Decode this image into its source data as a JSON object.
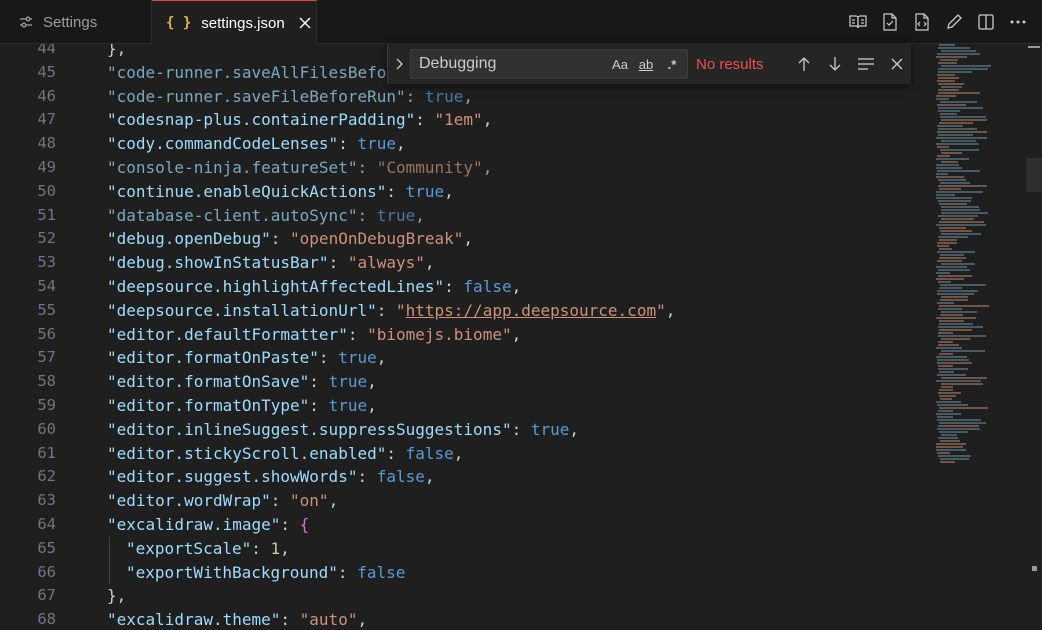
{
  "tabs": [
    {
      "label": "Settings",
      "icon": "settings-sliders-icon"
    },
    {
      "label": "settings.json",
      "icon": "json-braces-icon",
      "icon_text": "{ }",
      "active": true
    }
  ],
  "find": {
    "value": "Debugging",
    "options": {
      "match_case": "Aa",
      "whole_word": "ab",
      "regex": ".*"
    },
    "status": "No results"
  },
  "colors": {
    "key": "#9cdcfe",
    "string": "#ce9178",
    "keyword": "#569cd6",
    "number": "#b5cea8",
    "active_tab_border": "#e8443a",
    "no_results": "#f14c4c"
  },
  "lines": [
    {
      "num": "44",
      "text": "},"
    },
    {
      "num": "45",
      "key": "\"code-runner.saveAllFilesBeforeRun\"",
      "value": "true",
      "type": "kw",
      "dim": true
    },
    {
      "num": "46",
      "key": "\"code-runner.saveFileBeforeRun\"",
      "value": "true",
      "type": "kw",
      "dim": true
    },
    {
      "num": "47",
      "key": "\"codesnap-plus.containerPadding\"",
      "value": "\"1em\"",
      "type": "s"
    },
    {
      "num": "48",
      "key": "\"cody.commandCodeLenses\"",
      "value": "true",
      "type": "kw"
    },
    {
      "num": "49",
      "key": "\"console-ninja.featureSet\"",
      "value": "\"Community\"",
      "type": "s",
      "dim": true
    },
    {
      "num": "50",
      "key": "\"continue.enableQuickActions\"",
      "value": "true",
      "type": "kw"
    },
    {
      "num": "51",
      "key": "\"database-client.autoSync\"",
      "value": "true",
      "type": "kw",
      "dim": true
    },
    {
      "num": "52",
      "key": "\"debug.openDebug\"",
      "value": "\"openOnDebugBreak\"",
      "type": "s"
    },
    {
      "num": "53",
      "key": "\"debug.showInStatusBar\"",
      "value": "\"always\"",
      "type": "s"
    },
    {
      "num": "54",
      "key": "\"deepsource.highlightAffectedLines\"",
      "value": "false",
      "type": "kw"
    },
    {
      "num": "55",
      "key": "\"deepsource.installationUrl\"",
      "value": "https://app.deepsource.com",
      "type": "link"
    },
    {
      "num": "56",
      "key": "\"editor.defaultFormatter\"",
      "value": "\"biomejs.biome\"",
      "type": "s"
    },
    {
      "num": "57",
      "key": "\"editor.formatOnPaste\"",
      "value": "true",
      "type": "kw"
    },
    {
      "num": "58",
      "key": "\"editor.formatOnSave\"",
      "value": "true",
      "type": "kw"
    },
    {
      "num": "59",
      "key": "\"editor.formatOnType\"",
      "value": "true",
      "type": "kw"
    },
    {
      "num": "60",
      "key": "\"editor.inlineSuggest.suppressSuggestions\"",
      "value": "true",
      "type": "kw"
    },
    {
      "num": "61",
      "key": "\"editor.stickyScroll.enabled\"",
      "value": "false",
      "type": "kw"
    },
    {
      "num": "62",
      "key": "\"editor.suggest.showWords\"",
      "value": "false",
      "type": "kw"
    },
    {
      "num": "63",
      "key": "\"editor.wordWrap\"",
      "value": "\"on\"",
      "type": "s"
    },
    {
      "num": "64",
      "key": "\"excalidraw.image\"",
      "value": "{",
      "type": "br"
    },
    {
      "num": "65",
      "key": "\"exportScale\"",
      "value": "1",
      "type": "num",
      "indent": true
    },
    {
      "num": "66",
      "key": "\"exportWithBackground\"",
      "value": "false",
      "type": "kw",
      "indent": true,
      "last": true
    },
    {
      "num": "67",
      "text": "},"
    },
    {
      "num": "68",
      "key": "\"excalidraw.theme\"",
      "value": "\"auto\"",
      "type": "s"
    }
  ]
}
